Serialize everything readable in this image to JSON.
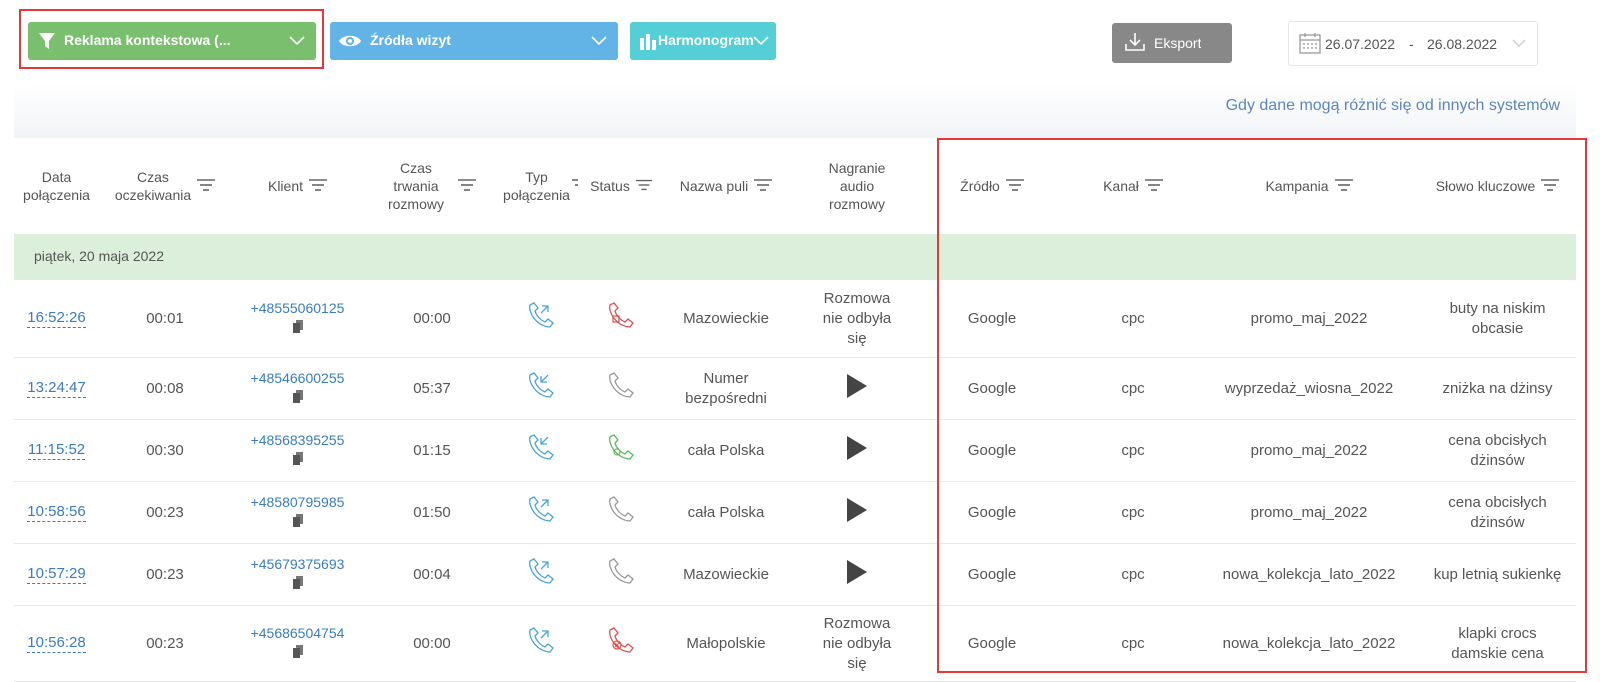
{
  "toolbar": {
    "filter_label": "Reklama kontekstowa (...",
    "sources_label": "Źródła wizyt",
    "schedule_label": "Harmonogram",
    "export_label": "Eksport",
    "date_from": "26.07.2022",
    "date_sep": "-",
    "date_to": "26.08.2022"
  },
  "notice": "Gdy dane mogą różnić się od innych systemów",
  "columns": {
    "date": [
      "Data",
      "połączenia"
    ],
    "wait": [
      "Czas",
      "oczekiwania"
    ],
    "client": "Klient",
    "duration": [
      "Czas",
      "trwania",
      "rozmowy"
    ],
    "type": [
      "Typ",
      "połączenia"
    ],
    "status": "Status",
    "pool": "Nazwa puli",
    "audio": [
      "Nagranie",
      "audio",
      "rozmowy"
    ],
    "source": "Źródło",
    "channel": "Kanał",
    "campaign": "Kampania",
    "keyword": "Słowo kluczowe"
  },
  "group_label": "piątek, 20 maja 2022",
  "rows": [
    {
      "time": "16:52:26",
      "wait": "00:01",
      "client": "+48555060125",
      "duration": "00:00",
      "type": "outgoing",
      "status": "missed-red",
      "pool": "Mazowieckie",
      "audio": "Rozmowa nie odbyła się",
      "source": "Google",
      "channel": "cpc",
      "campaign": "promo_maj_2022",
      "keyword": "buty na niskim obcasie"
    },
    {
      "time": "13:24:47",
      "wait": "00:08",
      "client": "+48546600255",
      "duration": "05:37",
      "type": "incoming",
      "status": "answered-gray",
      "pool": "Numer bezpośredni",
      "audio": "play",
      "source": "Google",
      "channel": "cpc",
      "campaign": "wyprzedaż_wiosna_2022",
      "keyword": "zniżka na dżinsy"
    },
    {
      "time": "11:15:52",
      "wait": "00:30",
      "client": "+48568395255",
      "duration": "01:15",
      "type": "incoming",
      "status": "answered-green",
      "pool": "cała Polska",
      "audio": "play",
      "source": "Google",
      "channel": "cpc",
      "campaign": "promo_maj_2022",
      "keyword": "cena obcisłych dżinsów"
    },
    {
      "time": "10:58:56",
      "wait": "00:23",
      "client": "+48580795985",
      "duration": "01:50",
      "type": "outgoing",
      "status": "answered-gray",
      "pool": "cała Polska",
      "audio": "play",
      "source": "Google",
      "channel": "cpc",
      "campaign": "promo_maj_2022",
      "keyword": "cena obcisłych dżinsów"
    },
    {
      "time": "10:57:29",
      "wait": "00:23",
      "client": "+45679375693",
      "duration": "00:04",
      "type": "outgoing",
      "status": "answered-gray",
      "pool": "Mazowieckie",
      "audio": "play",
      "source": "Google",
      "channel": "cpc",
      "campaign": "nowa_kolekcja_lato_2022",
      "keyword": "kup letnią sukienkę"
    },
    {
      "time": "10:56:28",
      "wait": "00:23",
      "client": "+45686504754",
      "duration": "00:00",
      "type": "outgoing",
      "status": "rejected-red",
      "pool": "Małopolskie",
      "audio": "Rozmowa nie odbyła się",
      "source": "Google",
      "channel": "cpc",
      "campaign": "nowa_kolekcja_lato_2022",
      "keyword": "klapki crocs damskie cena"
    }
  ],
  "colors": {
    "filter_green": "#79bf6e",
    "sources_blue": "#62b3e6",
    "schedule_teal": "#53cfd5",
    "export_gray": "#888888",
    "link_blue": "#3a7cc0",
    "group_green": "#dcefdb",
    "highlight_red": "#e53935"
  }
}
